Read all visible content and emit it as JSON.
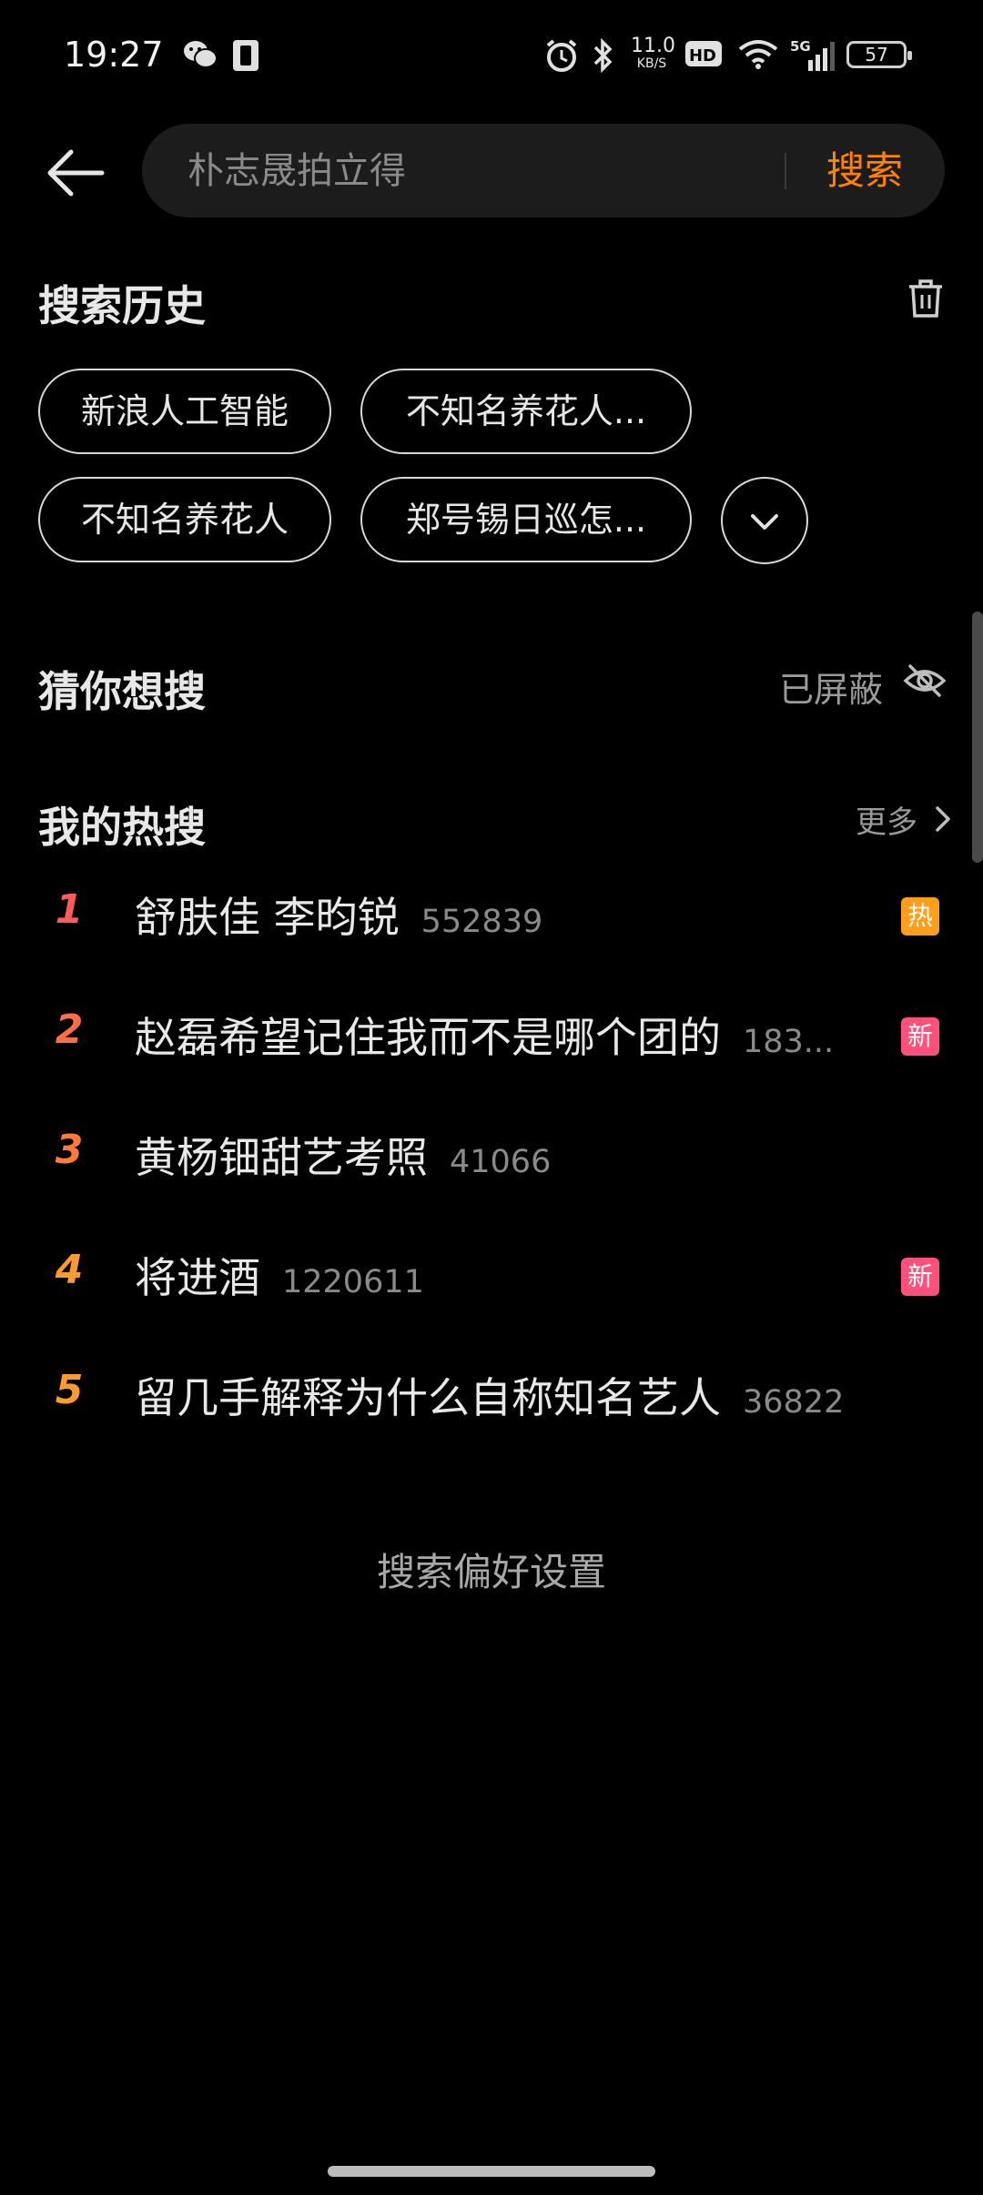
{
  "status_bar": {
    "time": "19:27",
    "net_speed_value": "11.0",
    "net_speed_unit": "KB/S",
    "network": "5G",
    "battery": "57",
    "icons": [
      "wechat-icon",
      "phone-icon",
      "alarm-icon",
      "bluetooth-icon",
      "hd-icon",
      "wifi-icon",
      "signal-icon",
      "battery-icon"
    ]
  },
  "search": {
    "placeholder": "朴志晟拍立得",
    "button_label": "搜索"
  },
  "history": {
    "title": "搜索历史",
    "chips": [
      "新浪人工智能",
      "不知名养花人...",
      "不知名养花人",
      "郑号锡日巡怎..."
    ]
  },
  "guess": {
    "title": "猜你想搜",
    "status_label": "已屏蔽"
  },
  "hot": {
    "title": "我的热搜",
    "more_label": "更多",
    "items": [
      {
        "rank": "1",
        "title": "舒肤佳 李昀锐",
        "count": "552839",
        "badge": "热",
        "rank_color": "#ff5b5b",
        "badge_color": "#ff9e1b"
      },
      {
        "rank": "2",
        "title": "赵磊希望记住我而不是哪个团的",
        "count": "183...",
        "badge": "新",
        "rank_color": "#ff6e48",
        "badge_color": "#ff4f7b"
      },
      {
        "rank": "3",
        "title": "黄杨钿甜艺考照",
        "count": "41066",
        "badge": "",
        "rank_color": "#ff7b3a",
        "badge_color": ""
      },
      {
        "rank": "4",
        "title": "将进酒",
        "count": "1220611",
        "badge": "新",
        "rank_color": "#ff9a2e",
        "badge_color": "#ff4f7b"
      },
      {
        "rank": "5",
        "title": "留几手解释为什么自称知名艺人",
        "count": "36822",
        "badge": "",
        "rank_color": "#ff9a2e",
        "badge_color": ""
      }
    ]
  },
  "footer": {
    "preferences_label": "搜索偏好设置"
  }
}
